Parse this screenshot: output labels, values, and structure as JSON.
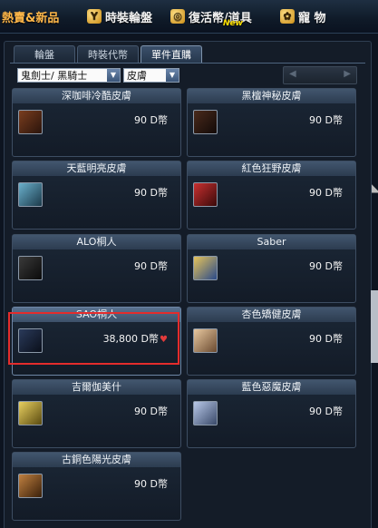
{
  "topbar": {
    "items": [
      {
        "label": "熱賣&新品"
      },
      {
        "label": "時裝輪盤"
      },
      {
        "label": "復活幣/道具"
      },
      {
        "label": "寵 物"
      }
    ],
    "new_tag": "New"
  },
  "tabs": [
    {
      "label": "輪盤"
    },
    {
      "label": "時裝代幣"
    },
    {
      "label": "單件直購"
    }
  ],
  "filters": {
    "class_select": "鬼劍士/ 黑騎士",
    "category_select": "皮膚"
  },
  "items": [
    {
      "title": "深咖啡冷酷皮膚",
      "price": "90 D幣"
    },
    {
      "title": "黑檀神秘皮膚",
      "price": "90 D幣"
    },
    {
      "title": "天藍明亮皮膚",
      "price": "90 D幣"
    },
    {
      "title": "紅色狂野皮膚",
      "price": "90 D幣"
    },
    {
      "title": "ALO桐人",
      "price": "90 D幣"
    },
    {
      "title": "Saber",
      "price": "90 D幣"
    },
    {
      "title": "SAO桐人",
      "price": "38,800 D幣"
    },
    {
      "title": "杏色矯健皮膚",
      "price": "90 D幣"
    },
    {
      "title": "吉爾伽美什",
      "price": "90 D幣"
    },
    {
      "title": "藍色惡魔皮膚",
      "price": "90 D幣"
    },
    {
      "title": "古銅色陽光皮膚",
      "price": "90 D幣"
    }
  ],
  "colors": {
    "highlight": "#e42c2c",
    "hot_text": "#ffb84a"
  }
}
